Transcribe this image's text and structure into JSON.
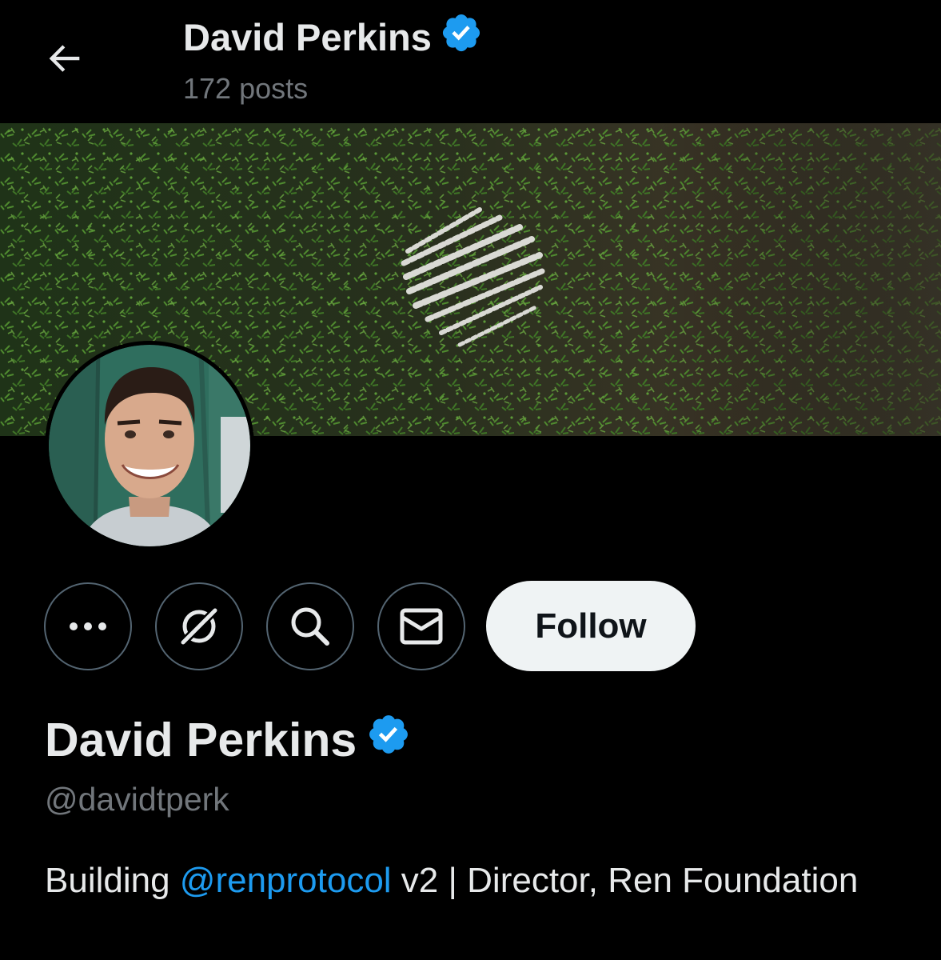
{
  "header": {
    "back_icon": "arrow-left-icon",
    "title": "David Perkins",
    "post_count": "172 posts",
    "verified_icon": "verified-badge-icon"
  },
  "profile": {
    "name": "David Perkins",
    "handle": "@davidtperk",
    "bio": {
      "prefix": "Building ",
      "mention": "@renprotocol",
      "suffix": " v2 | Director, Ren Foundation"
    }
  },
  "actions": {
    "more_icon": "more-horizontal-icon",
    "grok_icon": "grok-icon",
    "search_icon": "search-icon",
    "message_icon": "envelope-icon",
    "follow_label": "Follow"
  },
  "colors": {
    "background": "#000000",
    "text_primary": "#e7e9ea",
    "text_secondary": "#71767b",
    "accent": "#1d9bf0",
    "follow_button_bg": "#eff3f4",
    "follow_button_text": "#0f1419",
    "icon_border": "#536471"
  }
}
